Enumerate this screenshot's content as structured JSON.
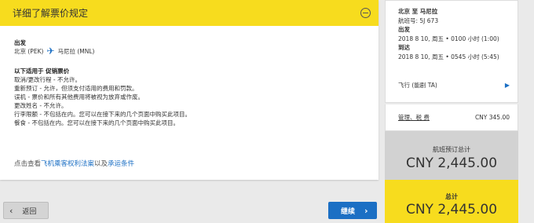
{
  "fare_rules": {
    "title": "详细了解票价规定",
    "departure_label": "出发",
    "origin": "北京 (PEK)",
    "destination": "马尼拉 (MNL)",
    "applies_to": "以下适用于 促销票价",
    "rules": [
      "取消/更改行程 - 不允许。",
      "重新预订 - 允许，但须支付适用的费用和罚款。",
      "误机 - 票价和所有其他费用将被视为放弃或作废。",
      "更改姓名 - 不允许。",
      "行李限额 - 不包括在内。您可以在接下来的几个页面中购买此项目。",
      "餐食 - 不包括在内。您可以在接下来的几个页面中购买此项目。"
    ],
    "footer_prefix": "点击查看",
    "footer_link1": "飞机乘客权利法案",
    "footer_mid": "以及",
    "footer_link2": "承运条件"
  },
  "nav": {
    "back_label": "返回",
    "next_label": "继续"
  },
  "summary": {
    "route": "北京 至 马尼拉",
    "flight_no": "航班号: 5J 673",
    "depart_label": "出发",
    "depart_time": "2018 8 10, 周五 • 0100 小时 (1:00)",
    "arrive_label": "到达",
    "arrive_time": "2018 8 10, 周五 • 0545 小时 (5:45)",
    "operator": "飞行 (能剧 TA)",
    "tax_label": "管理、税 费",
    "tax_amount": "CNY 345.00",
    "flight_total_label": "航班预订总计",
    "flight_total": "CNY 2,445.00",
    "grand_total_label": "总计",
    "grand_total": "CNY 2,445.00"
  },
  "colors": {
    "accent": "#f7dc1e",
    "primary": "#1b6fc4"
  }
}
